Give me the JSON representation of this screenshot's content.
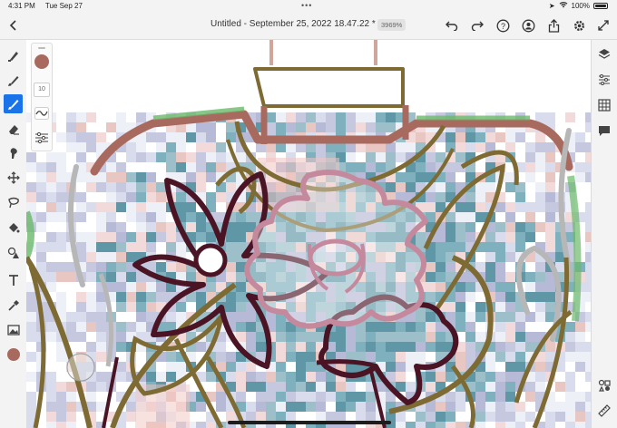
{
  "status": {
    "time": "4:31 PM",
    "date": "Tue Sep 27",
    "battery": "100%"
  },
  "document": {
    "title": "Untitled - September 25, 2022 18.47.22 *",
    "zoom": "3969%"
  },
  "brush_settings": {
    "size": "10"
  },
  "colors": {
    "accent": "#1a73e8",
    "current_color": "#a86a5e",
    "outline_brown": "#7e6a33",
    "dark_maroon": "#4a1425",
    "pink": "#c4899c",
    "teal_pixels": "#5f97a7",
    "green_pixels": "#6ab96a"
  },
  "icons": {
    "left_toolbar": [
      "pixel-brush-icon",
      "vector-brush-icon",
      "fill-brush-icon",
      "eraser-icon",
      "smudge-icon",
      "transform-icon",
      "lasso-icon",
      "paint-bucket-icon",
      "shape-icon",
      "text-icon",
      "eyedropper-icon",
      "image-icon",
      "color-swatch"
    ],
    "right_toolbar": [
      "layers-icon",
      "adjustments-icon",
      "grid-icon",
      "comment-icon",
      "assets-icon",
      "ruler-icon"
    ]
  }
}
